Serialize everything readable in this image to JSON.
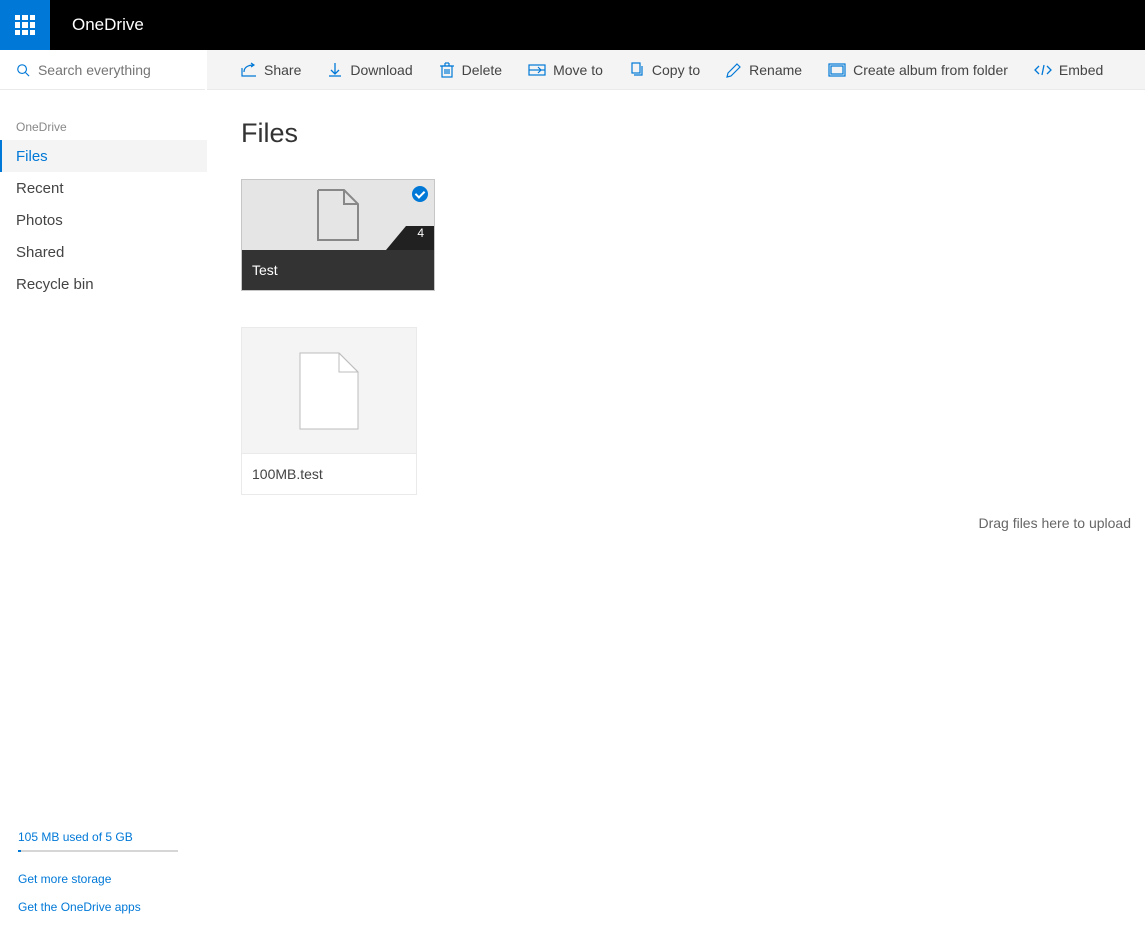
{
  "header": {
    "brand": "OneDrive"
  },
  "search": {
    "placeholder": "Search everything"
  },
  "sidebar": {
    "heading": "OneDrive",
    "items": [
      {
        "label": "Files",
        "active": true
      },
      {
        "label": "Recent",
        "active": false
      },
      {
        "label": "Photos",
        "active": false
      },
      {
        "label": "Shared",
        "active": false
      },
      {
        "label": "Recycle bin",
        "active": false
      }
    ],
    "storage": {
      "text": "105 MB used of 5 GB"
    },
    "links": {
      "more_storage": "Get more storage",
      "get_apps": "Get the OneDrive apps"
    }
  },
  "toolbar": {
    "buttons": [
      {
        "label": "Share",
        "icon": "share-icon"
      },
      {
        "label": "Download",
        "icon": "download-icon"
      },
      {
        "label": "Delete",
        "icon": "delete-icon"
      },
      {
        "label": "Move to",
        "icon": "moveto-icon"
      },
      {
        "label": "Copy to",
        "icon": "copyto-icon"
      },
      {
        "label": "Rename",
        "icon": "rename-icon"
      },
      {
        "label": "Create album from folder",
        "icon": "create-album-icon"
      },
      {
        "label": "Embed",
        "icon": "embed-icon"
      }
    ]
  },
  "page": {
    "title": "Files",
    "upload_hint": "Drag files here to upload"
  },
  "items": {
    "folder": {
      "name": "Test",
      "count": "4"
    },
    "file": {
      "name": "100MB.test"
    }
  },
  "colors": {
    "accent": "#0078d7"
  }
}
